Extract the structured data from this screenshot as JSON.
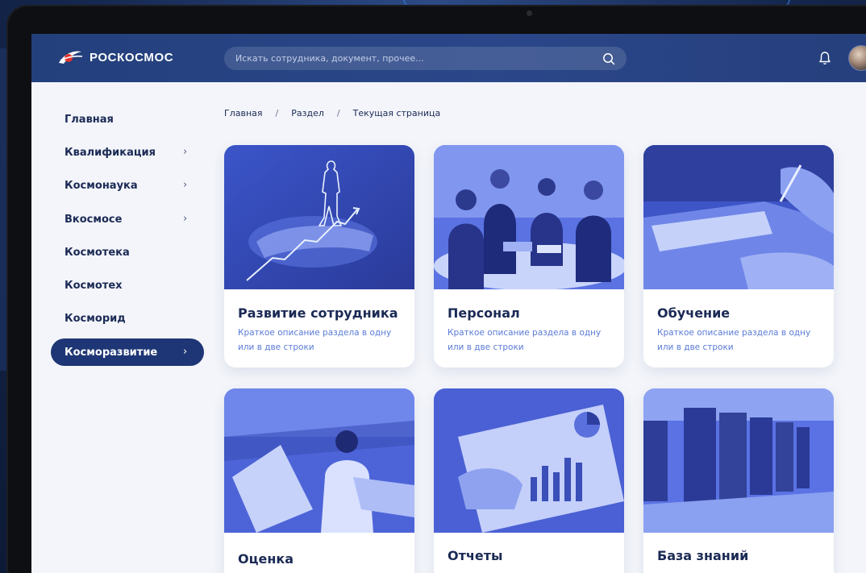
{
  "brand": {
    "name": "РОСКОСМОС"
  },
  "search": {
    "placeholder": "Искать сотрудника, документ, прочее..."
  },
  "sidebar": {
    "items": [
      {
        "label": "Главная",
        "has_arrow": false,
        "active": false
      },
      {
        "label": "Квалификация",
        "has_arrow": true,
        "active": false
      },
      {
        "label": "Космонаука",
        "has_arrow": true,
        "active": false
      },
      {
        "label": "Вкосмосе",
        "has_arrow": true,
        "active": false
      },
      {
        "label": "Космотека",
        "has_arrow": false,
        "active": false
      },
      {
        "label": "Космотех",
        "has_arrow": false,
        "active": false
      },
      {
        "label": "Косморид",
        "has_arrow": false,
        "active": false
      },
      {
        "label": "Косморазвитие",
        "has_arrow": true,
        "active": true
      }
    ],
    "arrow_glyph": "›"
  },
  "breadcrumb": {
    "items": [
      "Главная",
      "Раздел",
      "Текущая страница"
    ],
    "separator": "/"
  },
  "cards": [
    {
      "title": "Развитие сотрудника",
      "description": "Краткое описание раздела в одну или в две строки",
      "image_icon": "growth-hand-icon"
    },
    {
      "title": "Персонал",
      "description": "Краткое описание раздела в одну или в две строки",
      "image_icon": "team-meeting-icon"
    },
    {
      "title": "Обучение",
      "description": "Краткое описание раздела в одну или в две строки",
      "image_icon": "writing-notes-icon"
    },
    {
      "title": "Оценка",
      "description": "",
      "image_icon": "evaluation-icon"
    },
    {
      "title": "Отчеты",
      "description": "",
      "image_icon": "reports-chart-icon"
    },
    {
      "title": "База знаний",
      "description": "",
      "image_icon": "server-racks-icon"
    }
  ],
  "colors": {
    "header": "#2b4789",
    "accent": "#1e3675",
    "text_dark": "#1b2a55",
    "text_link": "#5a7bd6",
    "image_tint": "#4a63d8"
  }
}
